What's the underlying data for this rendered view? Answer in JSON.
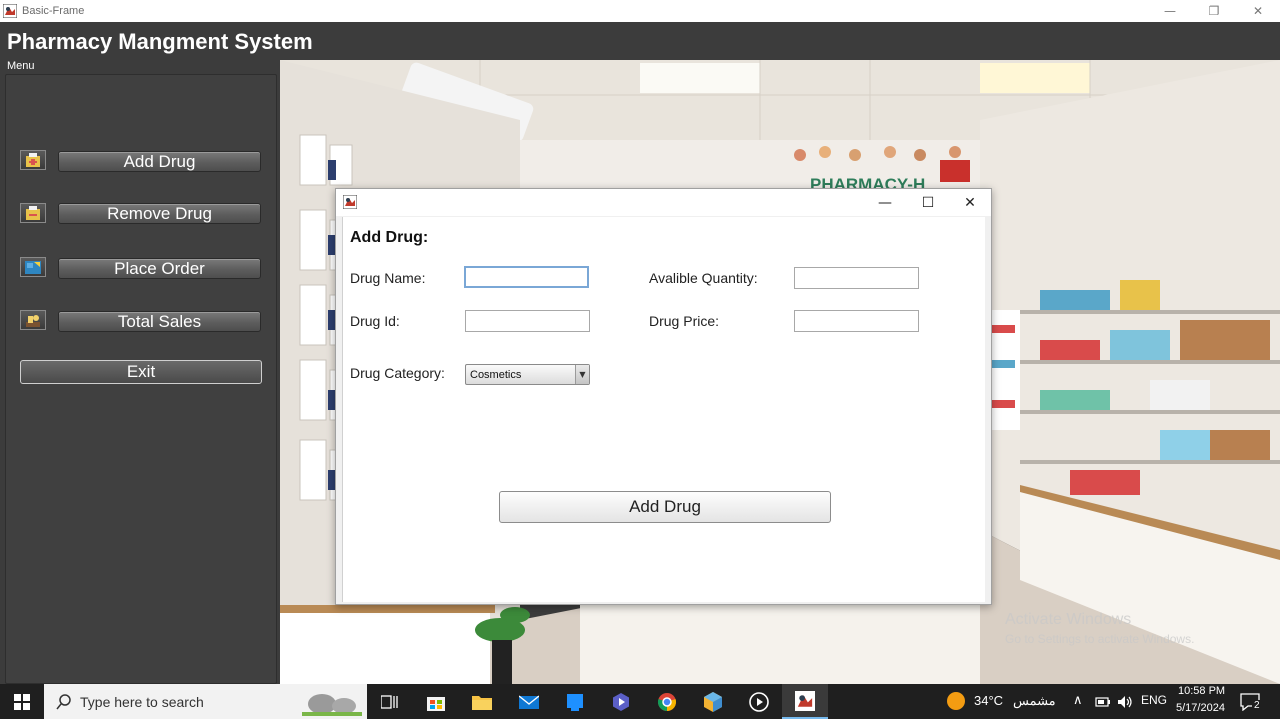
{
  "window": {
    "title": "Basic-Frame",
    "controls": {
      "minimize": "—",
      "restore": "❐",
      "close": "✕"
    }
  },
  "app": {
    "title": "Pharmacy Mangment System",
    "menu_label": "Menu"
  },
  "sidebar": {
    "items": [
      {
        "label": "Add Drug",
        "icon": "add-drug-icon"
      },
      {
        "label": "Remove Drug",
        "icon": "remove-drug-icon"
      },
      {
        "label": "Place Order",
        "icon": "place-order-icon"
      },
      {
        "label": "Total Sales",
        "icon": "total-sales-icon"
      }
    ],
    "exit_label": "Exit"
  },
  "dialog": {
    "controls": {
      "minimize": "—",
      "maximize": "☐",
      "close": "✕"
    },
    "heading": "Add Drug:",
    "fields": {
      "drug_name": {
        "label": "Drug Name:",
        "value": ""
      },
      "drug_id": {
        "label": "Drug Id:",
        "value": ""
      },
      "available_quantity": {
        "label": "Avalible Quantity:",
        "value": ""
      },
      "drug_price": {
        "label": "Drug Price:",
        "value": ""
      },
      "drug_category": {
        "label": "Drug Category:",
        "value": "Cosmetics"
      }
    },
    "submit_label": "Add Drug"
  },
  "background": {
    "sign_text": "PHARMACY-H"
  },
  "watermark": {
    "line1": "Activate Windows",
    "line2": "Go to Settings to activate Windows."
  },
  "taskbar": {
    "search_placeholder": "Type here to search",
    "weather_temp": "34°C",
    "weather_text": "مشمس",
    "language": "ENG",
    "time": "10:58 PM",
    "date": "5/17/2024",
    "notification_count": "2"
  },
  "colors": {
    "app_background": "#3c3c3c",
    "sidebar": "#404040",
    "taskbar": "#1f1f1f",
    "focus_border": "#7aa7d6"
  }
}
